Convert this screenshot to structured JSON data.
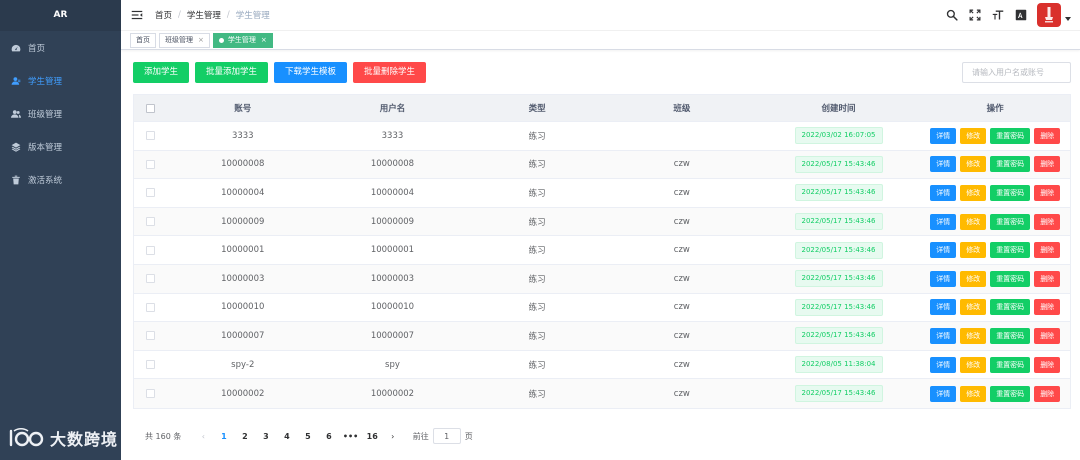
{
  "sidebar": {
    "logo": "AR",
    "items": [
      {
        "label": "首页",
        "icon": "dashboard-icon",
        "active": false
      },
      {
        "label": "学生管理",
        "icon": "user-icon",
        "active": true
      },
      {
        "label": "班级管理",
        "icon": "users-icon",
        "active": false
      },
      {
        "label": "版本管理",
        "icon": "layers-icon",
        "active": false
      },
      {
        "label": "激活系统",
        "icon": "trash-icon",
        "active": false
      }
    ]
  },
  "watermark": {
    "text": "大数跨境"
  },
  "header": {
    "breadcrumb": [
      "首页",
      "学生管理",
      "学生管理"
    ],
    "separator": "/"
  },
  "tags": [
    {
      "label": "首页",
      "active": false,
      "closable": false
    },
    {
      "label": "班级管理",
      "active": false,
      "closable": true
    },
    {
      "label": "学生管理",
      "active": true,
      "closable": true
    }
  ],
  "toolbar": {
    "add": "添加学生",
    "batch_add": "批量添加学生",
    "download": "下载学生模板",
    "batch_delete": "批量删除学生",
    "search_placeholder": "请输入用户名或账号"
  },
  "table": {
    "columns": [
      "账号",
      "用户名",
      "类型",
      "班级",
      "创建时间",
      "操作"
    ],
    "actions": {
      "detail": "详情",
      "edit": "修改",
      "reset": "重置密码",
      "delete": "删除"
    },
    "rows": [
      {
        "account": "3333",
        "username": "3333",
        "type": "练习",
        "class": "",
        "created": "2022/03/02 16:07:05"
      },
      {
        "account": "10000008",
        "username": "10000008",
        "type": "练习",
        "class": "czw",
        "created": "2022/05/17 15:43:46"
      },
      {
        "account": "10000004",
        "username": "10000004",
        "type": "练习",
        "class": "czw",
        "created": "2022/05/17 15:43:46"
      },
      {
        "account": "10000009",
        "username": "10000009",
        "type": "练习",
        "class": "czw",
        "created": "2022/05/17 15:43:46"
      },
      {
        "account": "10000001",
        "username": "10000001",
        "type": "练习",
        "class": "czw",
        "created": "2022/05/17 15:43:46"
      },
      {
        "account": "10000003",
        "username": "10000003",
        "type": "练习",
        "class": "czw",
        "created": "2022/05/17 15:43:46"
      },
      {
        "account": "10000010",
        "username": "10000010",
        "type": "练习",
        "class": "czw",
        "created": "2022/05/17 15:43:46"
      },
      {
        "account": "10000007",
        "username": "10000007",
        "type": "练习",
        "class": "czw",
        "created": "2022/05/17 15:43:46"
      },
      {
        "account": "spy-2",
        "username": "spy",
        "type": "练习",
        "class": "czw",
        "created": "2022/08/05 11:38:04"
      },
      {
        "account": "10000002",
        "username": "10000002",
        "type": "练习",
        "class": "czw",
        "created": "2022/05/17 15:43:46"
      }
    ]
  },
  "pagination": {
    "total": "共 160 条",
    "pages": [
      "1",
      "2",
      "3",
      "4",
      "5",
      "6",
      "•••",
      "16"
    ],
    "current": "1",
    "goto_prefix": "前往",
    "goto_value": "1",
    "goto_suffix": "页"
  },
  "colors": {
    "sidebar_bg": "#304156",
    "active_menu": "#409eff",
    "green": "#13ce66",
    "blue": "#1890ff",
    "red": "#ff4949",
    "yellow": "#ffba00",
    "tag_active": "#42b983"
  }
}
